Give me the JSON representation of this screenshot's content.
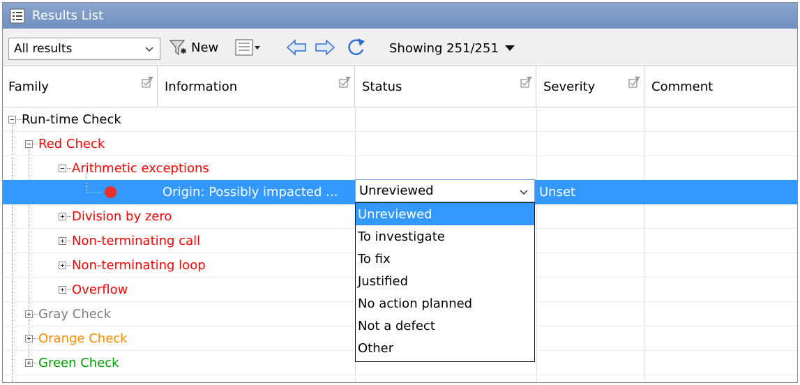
{
  "window": {
    "title": "Results List"
  },
  "toolbar": {
    "filter_value": "All results",
    "new_label": "New",
    "showing_label": "Showing 251/251"
  },
  "columns": [
    "Family",
    "Information",
    "Status",
    "Severity",
    "Comment"
  ],
  "tree": {
    "runtime": "Run-time Check",
    "red": "Red Check",
    "arith": "Arithmetic exceptions",
    "div": "Division by zero",
    "nonterm_call": "Non-terminating call",
    "nonterm_loop": "Non-terminating loop",
    "overflow": "Overflow",
    "gray": "Gray Check",
    "orange": "Orange Check",
    "green": "Green Check"
  },
  "selected_row": {
    "information": "Origin: Possibly impacted ...",
    "status": "Unreviewed",
    "severity": "Unset"
  },
  "status_options": [
    "Unreviewed",
    "To investigate",
    "To fix",
    "Justified",
    "No action planned",
    "Not a defect",
    "Other"
  ],
  "colors": {
    "selection": "#3399ff",
    "red_check": "#ff0000",
    "gray_check": "#808080",
    "orange_check": "#ff8c00",
    "green_check": "#00a000"
  }
}
